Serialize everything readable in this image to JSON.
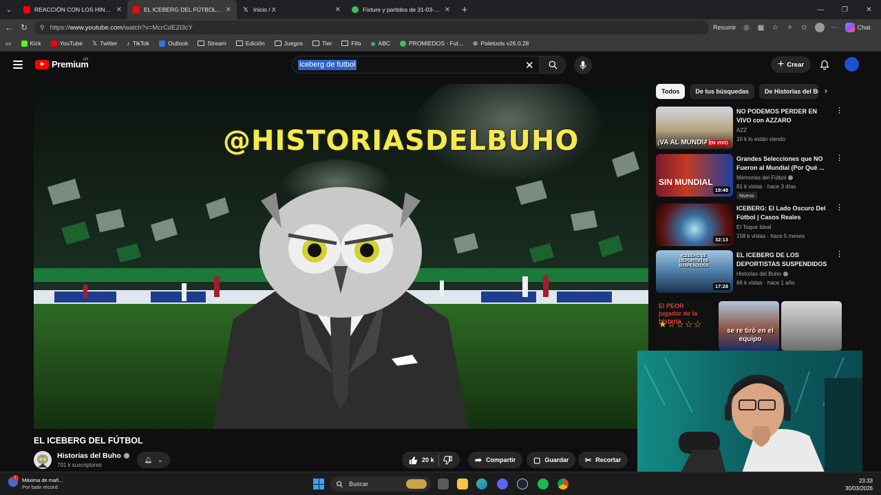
{
  "browser": {
    "tabs": [
      {
        "title": "REACCIÓN CON LOS HINCHAS / R",
        "favicon": "youtube-icon",
        "active": false
      },
      {
        "title": "EL ICEBERG DEL FÚTBOL - YouTube",
        "favicon": "youtube-icon",
        "active": true
      },
      {
        "title": "Inicio / X",
        "favicon": "x-icon",
        "active": false
      },
      {
        "title": "Fixture y partidos de 31-03-2026 d",
        "favicon": "promiedos-icon",
        "active": false
      }
    ],
    "url_prefix": "https://",
    "url_host": "www.youtube.com",
    "url_path": "/watch?v=McrCdE2I3cY",
    "resumir_label": "Resumir",
    "chat_label": "Chat",
    "bookmarks": [
      {
        "label": "Kick",
        "icon": "kick-icon"
      },
      {
        "label": "YouTube",
        "icon": "youtube-icon"
      },
      {
        "label": "Twitter",
        "icon": "x-icon"
      },
      {
        "label": "TikTok",
        "icon": "tiktok-icon"
      },
      {
        "label": "Outlook",
        "icon": "outlook-icon"
      },
      {
        "label": "Stream",
        "icon": "folder-icon"
      },
      {
        "label": "Edición",
        "icon": "folder-icon"
      },
      {
        "label": "Juegos",
        "icon": "folder-icon"
      },
      {
        "label": "Tier",
        "icon": "folder-icon"
      },
      {
        "label": "Fifa",
        "icon": "folder-icon"
      },
      {
        "label": "ABC",
        "icon": "abc-icon"
      },
      {
        "label": "PROMIEDOS - Fut...",
        "icon": "promiedos-icon"
      },
      {
        "label": "Paletools v26.0.28",
        "icon": "globe-icon"
      }
    ]
  },
  "youtube": {
    "brand": "Premium",
    "region": "AR",
    "search_query": "iceberg de futbol",
    "create_label": "Crear",
    "video": {
      "overlay_text": "@HISTORIASDELBUHO",
      "title": "EL ICEBERG DEL FÚTBOL",
      "channel": "Historias del Buho",
      "subscribers": "701 k suscriptores",
      "likes": "20 k",
      "share_label": "Compartir",
      "save_label": "Guardar",
      "clip_label": "Recortar"
    },
    "chips": [
      "Todos",
      "De tus búsquedas",
      "De Historias del Buho"
    ],
    "recommendations": [
      {
        "title": "NO PODEMOS PERDER EN VIVO con AZZARO",
        "channel": "AZZ",
        "meta": "10 k lo están viendo",
        "badge": "EN VIVO",
        "thumb_text": "¡VA AL MUNDIAL",
        "verified": false,
        "new": false
      },
      {
        "title": "Grandes Selecciones que NO Fueron al Mundial (Por Qué ...",
        "channel": "Memorias del Fútbol",
        "meta": "81 k vistas · hace 3 días",
        "duration": "19:48",
        "thumb_text": "SIN MUNDIAL",
        "verified": true,
        "new": true,
        "new_label": "Nuevo"
      },
      {
        "title": "ICEBERG: El Lado Oscuro Del Fútbol | Casos Reales",
        "channel": "El Toque Ideal",
        "meta": "158 k vistas · hace 5 meses",
        "duration": "32:13",
        "verified": false,
        "new": false
      },
      {
        "title": "EL ICEBERG DE LOS DEPORTISTAS SUSPENDIDOS",
        "channel": "Historias del Buho",
        "meta": "66 k vistas · hace 1 año",
        "duration": "17:28",
        "thumb_text": "ICEBERG DE DEPORTISTAS SUSPENDIDOS",
        "verified": true,
        "new": false
      }
    ],
    "shorts": [
      {
        "text": "El PEOR jugador de la historia"
      },
      {
        "text": "se re tiró en el equipo"
      },
      {
        "text": ""
      }
    ]
  },
  "taskbar": {
    "weather_title": "Máxima de mañ...",
    "weather_sub": "Por batir récord",
    "search_label": "Buscar",
    "time": "23:33",
    "date": "30/03/2026"
  }
}
